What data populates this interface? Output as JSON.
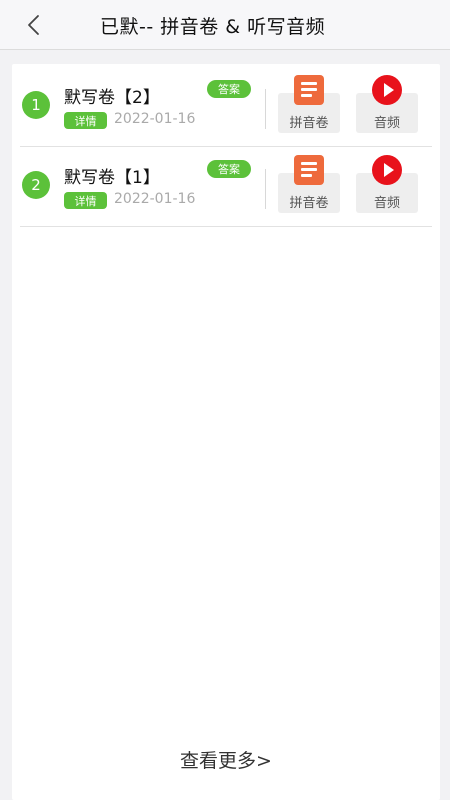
{
  "header": {
    "back_icon": "chevron-left-icon",
    "title": "已默-- 拼音卷 & 听写音频"
  },
  "items": [
    {
      "index": "1",
      "name": "默写卷【2】",
      "answer_badge": "答案",
      "detail_badge": "详情",
      "date": "2022-01-16",
      "pinyin_label": "拼音卷",
      "audio_label": "音频"
    },
    {
      "index": "2",
      "name": "默写卷【1】",
      "answer_badge": "答案",
      "detail_badge": "详情",
      "date": "2022-01-16",
      "pinyin_label": "拼音卷",
      "audio_label": "音频"
    }
  ],
  "footer": {
    "more_label": "查看更多>"
  },
  "colors": {
    "accent_green": "#5cc13a",
    "doc_orange": "#ee6a3c",
    "play_red": "#e8121b"
  }
}
